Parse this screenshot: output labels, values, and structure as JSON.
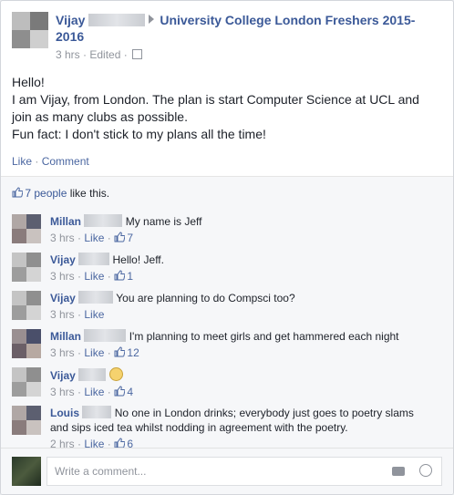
{
  "post": {
    "author_name": "Vijay",
    "group_name": "University College London Freshers 2015-2016",
    "time": "3 hrs",
    "edited": "Edited",
    "sep": "·",
    "body_lines": [
      "Hello!",
      "I am Vijay, from London. The plan is start Computer Science at UCL and join as many clubs as possible.",
      "Fun fact: I don't stick to my plans all the time!"
    ],
    "like_label": "Like",
    "comment_label": "Comment",
    "dot": " · "
  },
  "likes": {
    "people": "7 people",
    "suffix": " like this."
  },
  "comments": [
    {
      "name": "Millan",
      "text": "My name is Jeff",
      "time": "3 hrs",
      "like_label": "Like",
      "likes": "7"
    },
    {
      "name": "Vijay",
      "text": "Hello! Jeff.",
      "time": "3 hrs",
      "like_label": "Like",
      "likes": "1"
    },
    {
      "name": "Vijay",
      "text": "You are planning to do Compsci too?",
      "time": "3 hrs",
      "like_label": "Like",
      "likes": ""
    },
    {
      "name": "Millan",
      "text": "I'm planning to meet girls and get hammered each night",
      "time": "3 hrs",
      "like_label": "Like",
      "likes": "12"
    },
    {
      "name": "Vijay",
      "text": "",
      "time": "3 hrs",
      "like_label": "Like",
      "likes": "4"
    },
    {
      "name": "Louis",
      "text": "No one in London drinks; everybody just goes to poetry slams and sips iced tea whilst nodding in agreement with the poetry.",
      "time": "2 hrs",
      "like_label": "Like",
      "likes": "6"
    }
  ],
  "composer": {
    "placeholder": "Write a comment..."
  },
  "icons": [
    "arrow-right-icon",
    "privacy-icon",
    "thumbs-up-icon",
    "smile-emoji-icon",
    "camera-icon",
    "emoji-icon"
  ],
  "colors": {
    "link": "#3b5998",
    "meta": "#90949c",
    "bg": "#f6f7f9"
  }
}
